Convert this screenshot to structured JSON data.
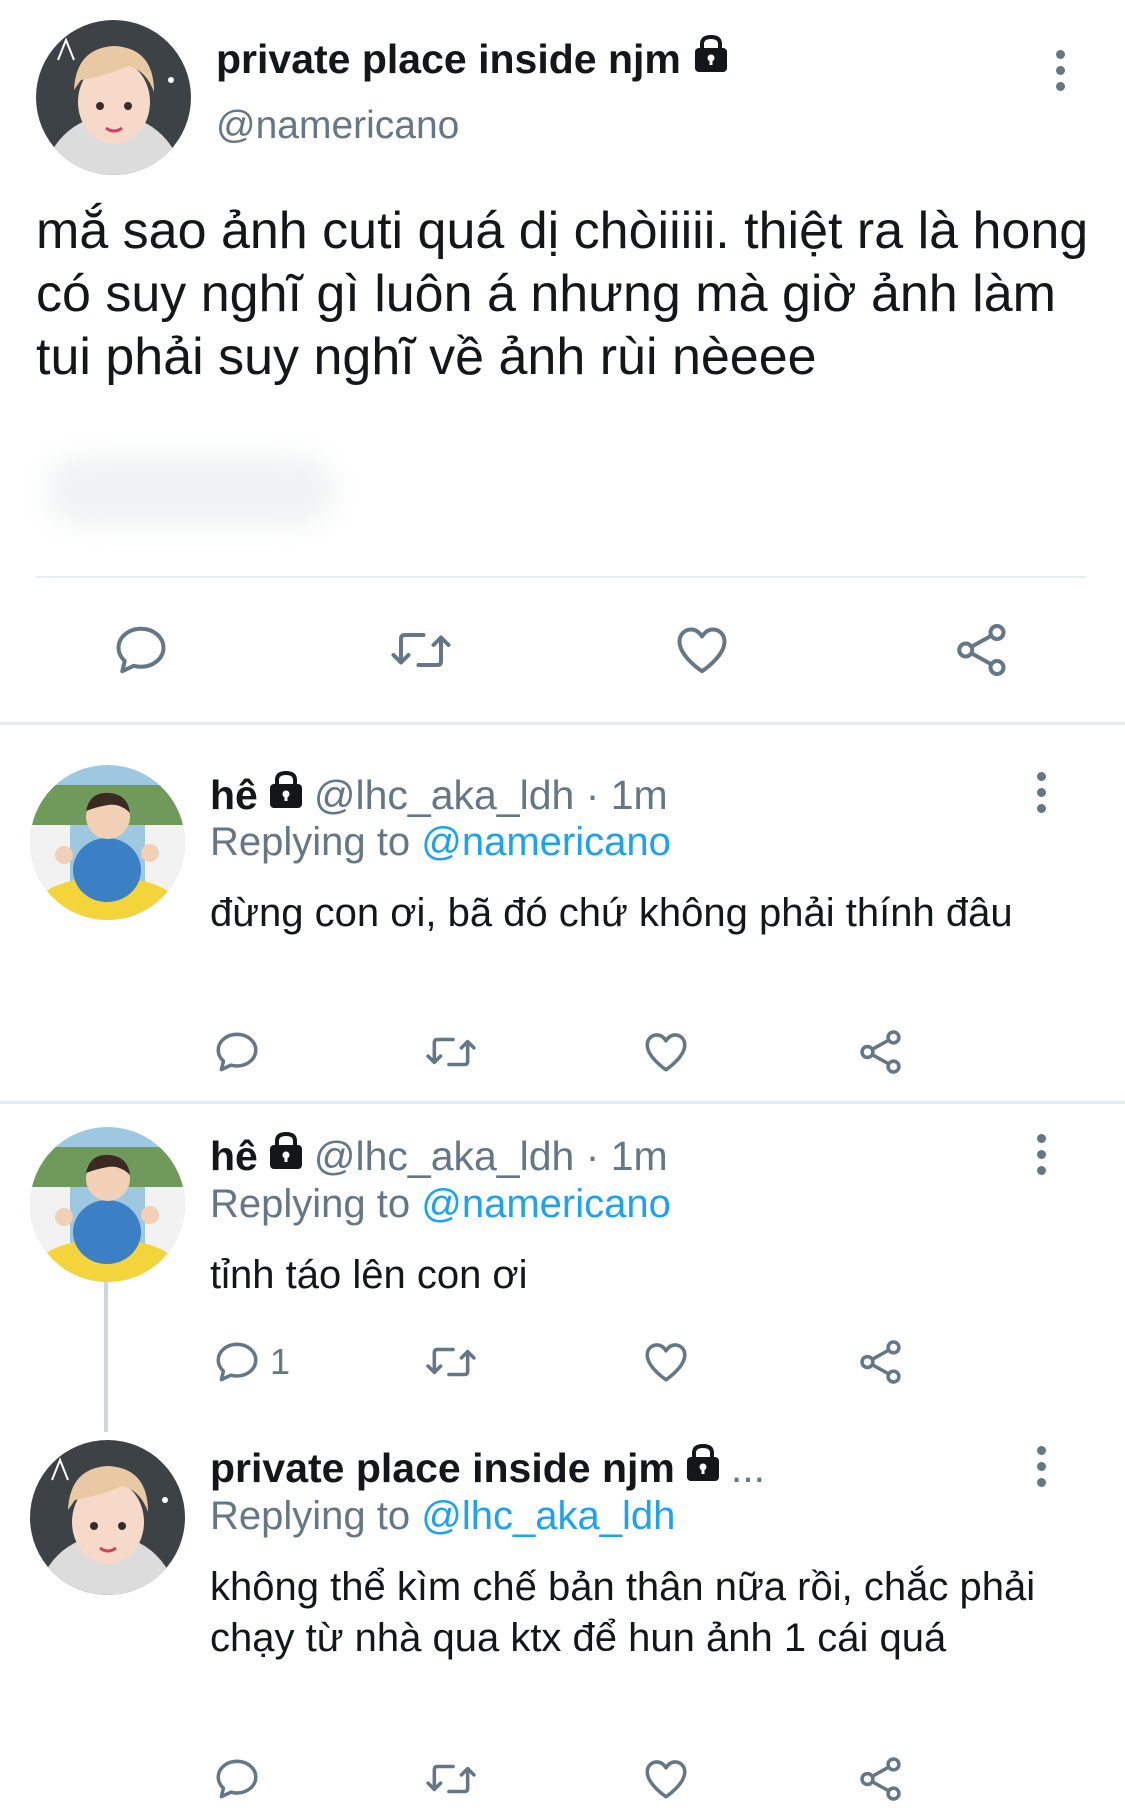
{
  "main_tweet": {
    "display_name": "private place inside njm",
    "handle": "@namericano",
    "text": "mắ sao ảnh cuti quá dị chòiiiii. thiệt ra là hong có suy nghĩ gì luôn á nhưng mà giờ ảnh làm tui phải suy nghĩ về ảnh rùi nèeee"
  },
  "replies": [
    {
      "name": "hê",
      "handle_time": "@lhc_aka_ldh · 1m",
      "replying_prefix": "Replying to",
      "replying_to": "@namericano",
      "text": "đừng con ơi, bã đó chứ không phải thính đâu",
      "reply_count": ""
    },
    {
      "name": "hê",
      "handle_time": "@lhc_aka_ldh · 1m",
      "replying_prefix": "Replying to",
      "replying_to": "@namericano",
      "text": "tỉnh táo lên con ơi",
      "reply_count": "1"
    },
    {
      "name": "private place inside njm",
      "handle_time": "...",
      "replying_prefix": "Replying to",
      "replying_to": "@lhc_aka_ldh",
      "text": "không thể kìm chế bản thân nữa rồi, chắc phải chạy từ nhà qua ktx để hun ảnh 1 cái quá",
      "reply_count": ""
    }
  ],
  "icons": {
    "reply": "reply-icon",
    "retweet": "retweet-icon",
    "like": "heart-icon",
    "share": "share-icon",
    "more": "more-icon",
    "lock": "lock-icon"
  },
  "colors": {
    "text": "#14171a",
    "muted": "#657786",
    "link": "#1da1f2",
    "divider": "#e6ecf0"
  }
}
